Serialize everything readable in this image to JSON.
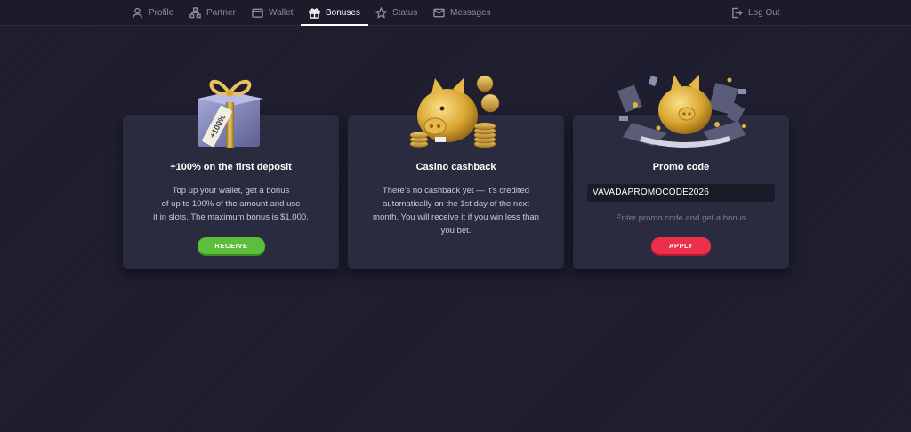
{
  "nav": {
    "items": [
      {
        "label": "Profile",
        "icon": "user-icon"
      },
      {
        "label": "Partner",
        "icon": "partner-icon"
      },
      {
        "label": "Wallet",
        "icon": "wallet-icon"
      },
      {
        "label": "Bonuses",
        "icon": "gift-icon",
        "active": true
      },
      {
        "label": "Status",
        "icon": "star-icon"
      },
      {
        "label": "Messages",
        "icon": "mail-icon"
      }
    ],
    "logout_label": "Log Out"
  },
  "cards": {
    "deposit": {
      "title": "+100% on the first deposit",
      "line1": "Top up your wallet, get a bonus",
      "line2": "of up to 100% of the amount and use",
      "line3": "it in slots. The maximum bonus is $1,000.",
      "button": "RECEIVE",
      "tag_text": "+100%"
    },
    "cashback": {
      "title": "Casino cashback",
      "line1": "There's no cashback yet — it's credited",
      "line2": "automatically on the 1st day of the next",
      "line3": "month. You will receive it if you win less than",
      "line4": "you bet."
    },
    "promo": {
      "title": "Promo code",
      "code": "VAVADAPROMOCODE2026",
      "hint": "Enter promo code and get a bonus",
      "button": "APPLY"
    }
  },
  "colors": {
    "background": "#1d1d2e",
    "card": "#2b2b40",
    "receive_green": "#5cbe3a",
    "apply_red": "#ee2f4c"
  }
}
